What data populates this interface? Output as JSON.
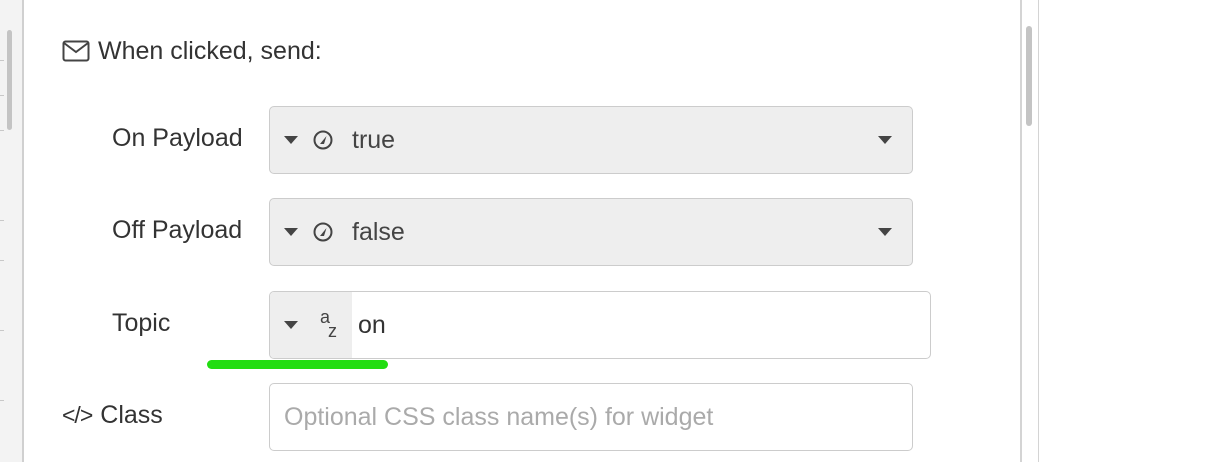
{
  "section": {
    "title": "When clicked, send:",
    "icon": "envelope-icon"
  },
  "on_payload": {
    "label": "On Payload",
    "type_icon": "boolean-icon",
    "value": "true"
  },
  "off_payload": {
    "label": "Off Payload",
    "type_icon": "boolean-icon",
    "value": "false"
  },
  "topic": {
    "label": "Topic",
    "type_icon": "string-az-icon",
    "type_glyph_a": "a",
    "type_glyph_z": "z",
    "value": "on"
  },
  "class_field": {
    "label": "Class",
    "icon": "code-icon",
    "icon_glyph": "</>",
    "value": "",
    "placeholder": "Optional CSS class name(s) for widget"
  },
  "colors": {
    "highlight": "#22dd11",
    "field_bg": "#eeeeee",
    "border": "#cccccc"
  }
}
